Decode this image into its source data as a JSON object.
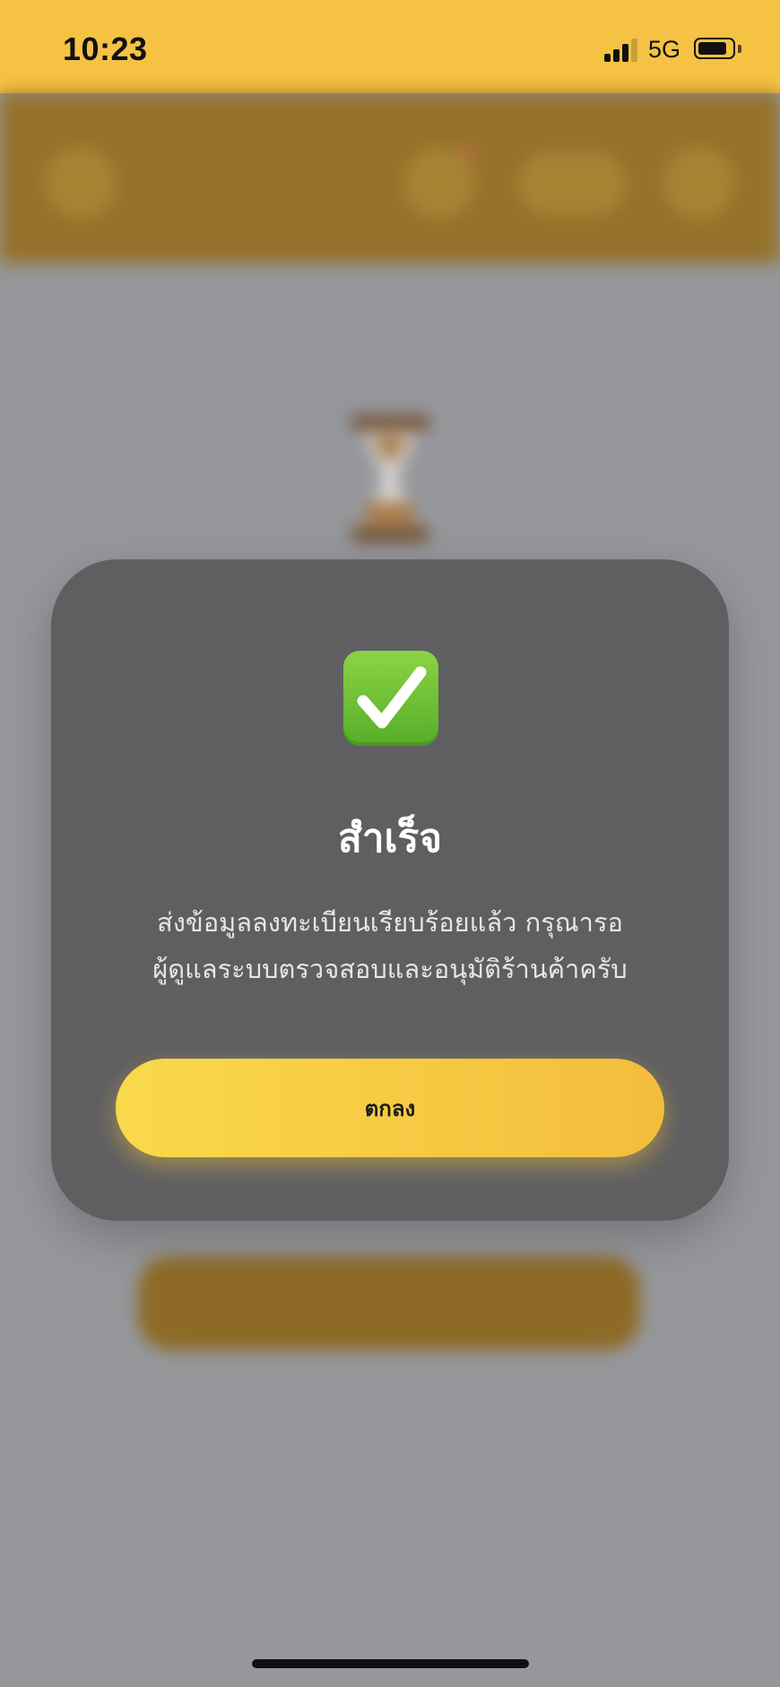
{
  "status_bar": {
    "time": "10:23",
    "network": "5G",
    "signal_bars_active": 3,
    "signal_bars_total": 4,
    "battery_level": 0.85,
    "background_color": "#f5c244"
  },
  "dialog": {
    "icon": "check-mark-button-icon",
    "title": "สำเร็จ",
    "message_line_1": "ส่งข้อมูลลงทะเบียนเรียบร้อยแล้ว กรุณารอ",
    "message_line_2": "ผู้ดูแลระบบตรวจสอบและอนุมัติร้านค้าครับ",
    "ok_button_label": "ตกลง",
    "button_color_start": "#f9d94c",
    "button_color_end": "#f4bd3c"
  },
  "background_screen": {
    "header_icons": [
      "menu-icon",
      "cart-icon",
      "language-icon",
      "profile-icon"
    ],
    "hero_icon": "hourglass-icon",
    "header_color": "#95722b",
    "blurred": true
  }
}
